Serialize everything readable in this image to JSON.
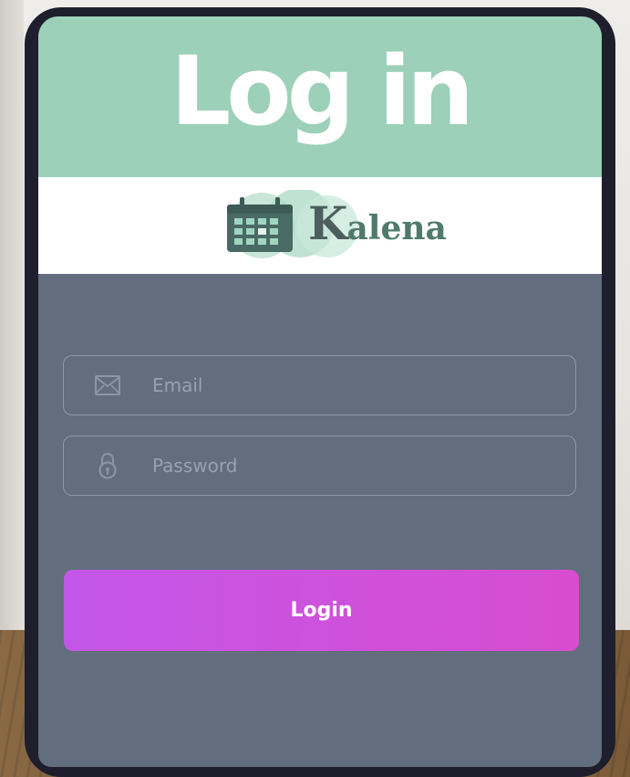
{
  "header": {
    "title": "Log in"
  },
  "logo": {
    "initial": "K",
    "rest": "alena",
    "icon": "calendar-icon"
  },
  "form": {
    "email": {
      "placeholder": "Email",
      "value": "",
      "icon": "envelope-icon"
    },
    "password": {
      "placeholder": "Password",
      "value": "",
      "icon": "lock-icon"
    },
    "login_label": "Login"
  },
  "colors": {
    "header_bg": "#9cd0b8",
    "screen_bg": "#626e7e",
    "device_frame": "#1f1e2c",
    "button_start": "#c356e8",
    "button_end": "#d84dd0",
    "logo_text": "#4e5e5e",
    "logo_accent": "#4f7a6c"
  }
}
